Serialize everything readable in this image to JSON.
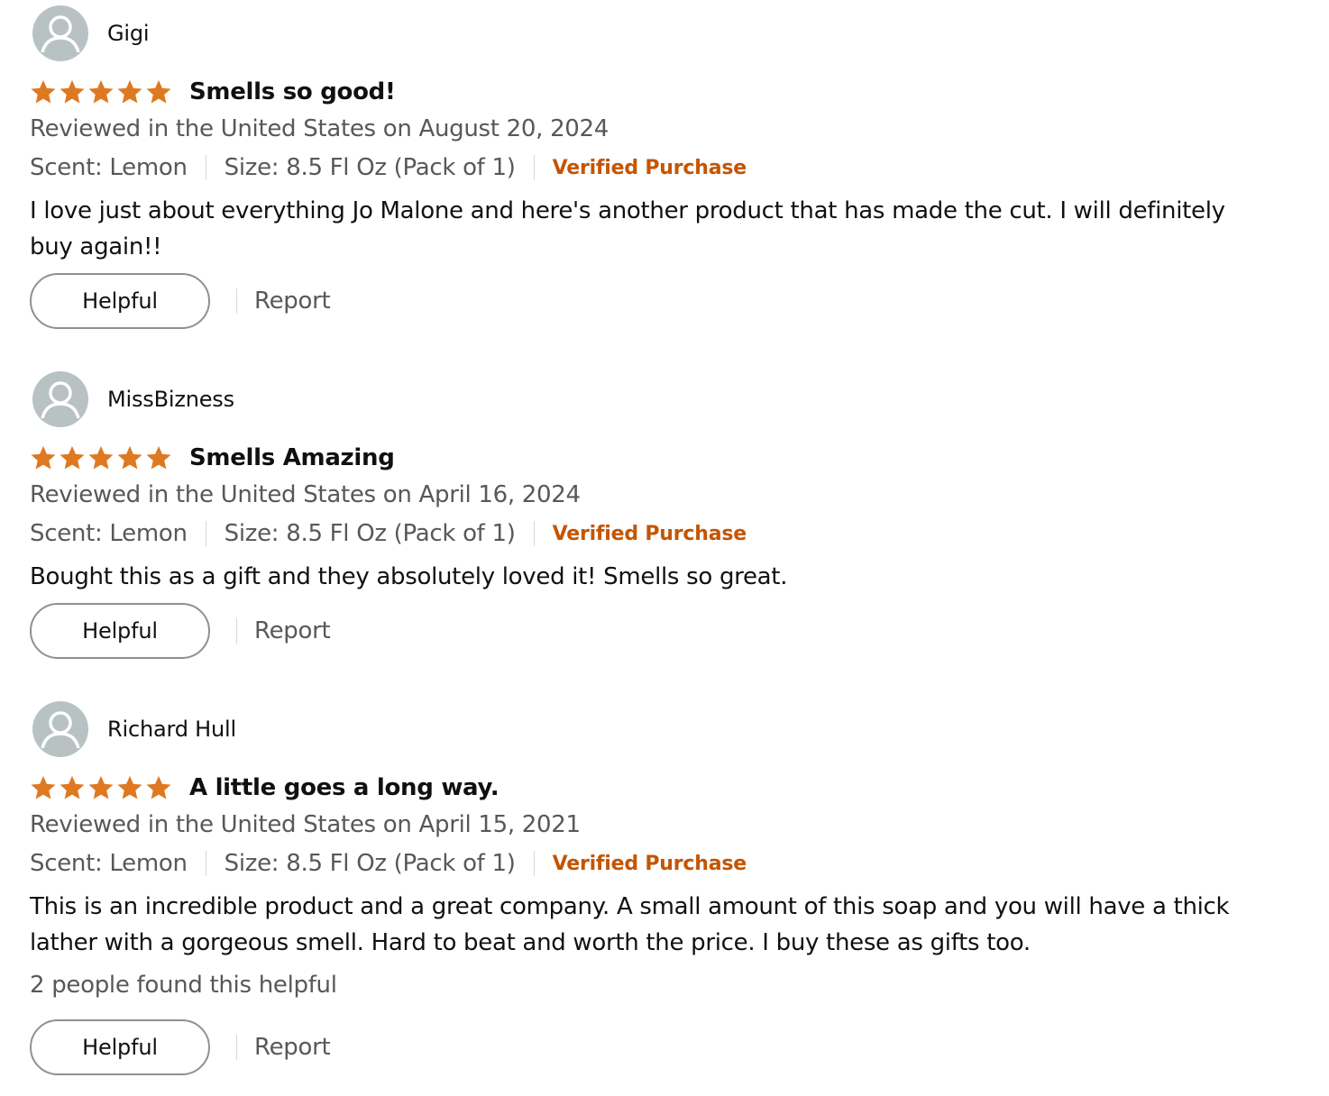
{
  "colors": {
    "star": "#de7921",
    "verified": "#c45500",
    "secondary_text": "#565959",
    "primary_text": "#0f1111",
    "avatar_bg": "#b8c2c2"
  },
  "reviews": [
    {
      "reviewer": "Gigi",
      "avatar_icon": "user-avatar-icon",
      "rating": 5,
      "title": "Smells so good!",
      "date_line": "Reviewed in the United States on August 20, 2024",
      "scent": "Scent: Lemon",
      "size": "Size: 8.5 Fl Oz (Pack of 1)",
      "verified": "Verified Purchase",
      "body": "I love just about everything Jo Malone and here's another product that has made the cut. I will definitely buy again!!",
      "helpful_count": "",
      "helpful_label": "Helpful",
      "report_label": "Report"
    },
    {
      "reviewer": "MissBizness",
      "avatar_icon": "user-avatar-icon",
      "rating": 5,
      "title": "Smells Amazing",
      "date_line": "Reviewed in the United States on April 16, 2024",
      "scent": "Scent: Lemon",
      "size": "Size: 8.5 Fl Oz (Pack of 1)",
      "verified": "Verified Purchase",
      "body": "Bought this as a gift and they absolutely loved it! Smells so great.",
      "helpful_count": "",
      "helpful_label": "Helpful",
      "report_label": "Report"
    },
    {
      "reviewer": "Richard Hull",
      "avatar_icon": "user-avatar-icon",
      "rating": 5,
      "title": "A little goes a long way.",
      "date_line": "Reviewed in the United States on April 15, 2021",
      "scent": "Scent: Lemon",
      "size": "Size: 8.5 Fl Oz (Pack of 1)",
      "verified": "Verified Purchase",
      "body": "This is an incredible product and a great company. A small amount of this soap and you will have a thick lather with a gorgeous smell. Hard to beat and worth the price. I buy these as gifts too.",
      "helpful_count": "2 people found this helpful",
      "helpful_label": "Helpful",
      "report_label": "Report"
    }
  ]
}
